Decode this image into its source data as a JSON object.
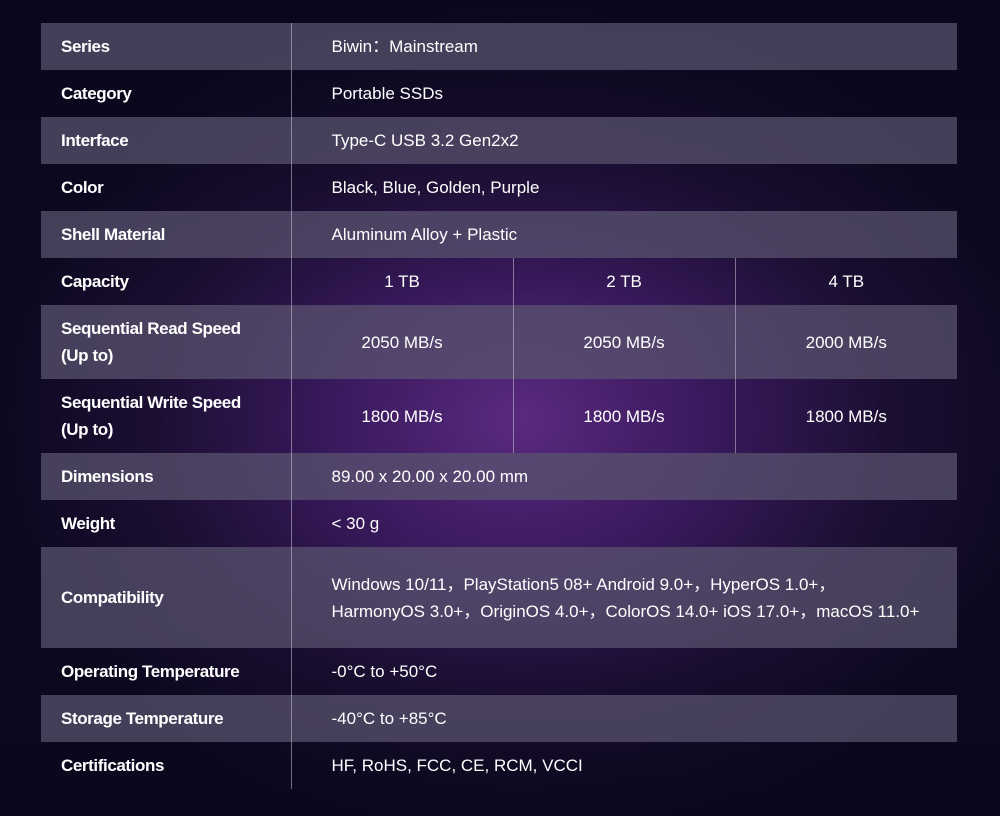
{
  "rows": {
    "series": {
      "label": "Series",
      "value": "Biwin：Mainstream"
    },
    "category": {
      "label": "Category",
      "value": "Portable SSDs"
    },
    "interface": {
      "label": "Interface",
      "value": "Type-C USB 3.2 Gen2x2"
    },
    "color": {
      "label": "Color",
      "value": "Black, Blue, Golden, Purple"
    },
    "shell": {
      "label": "Shell Material",
      "value": "Aluminum Alloy + Plastic"
    },
    "capacity": {
      "label": "Capacity",
      "values": [
        "1 TB",
        "2 TB",
        "4 TB"
      ]
    },
    "read": {
      "label_line1": "Sequential Read Speed",
      "label_line2": "(Up to)",
      "values": [
        "2050 MB/s",
        "2050 MB/s",
        "2000 MB/s"
      ]
    },
    "write": {
      "label_line1": "Sequential Write Speed",
      "label_line2": "(Up to)",
      "values": [
        "1800 MB/s",
        "1800 MB/s",
        "1800 MB/s"
      ]
    },
    "dimensions": {
      "label": "Dimensions",
      "value": "89.00 x 20.00 x 20.00 mm"
    },
    "weight": {
      "label": "Weight",
      "value": "< 30 g"
    },
    "compatibility": {
      "label": "Compatibility",
      "value": "Windows 10/11，PlayStation5 08+ Android 9.0+，HyperOS 1.0+，HarmonyOS 3.0+，OriginOS 4.0+，ColorOS 14.0+ iOS 17.0+，macOS 11.0+"
    },
    "op_temp": {
      "label": "Operating Temperature",
      "value": "-0°C to +50°C"
    },
    "storage_temp": {
      "label": "Storage Temperature",
      "value": "-40°C to +85°C"
    },
    "certifications": {
      "label": "Certifications",
      "value": "HF, RoHS, FCC, CE, RCM, VCCI"
    }
  }
}
